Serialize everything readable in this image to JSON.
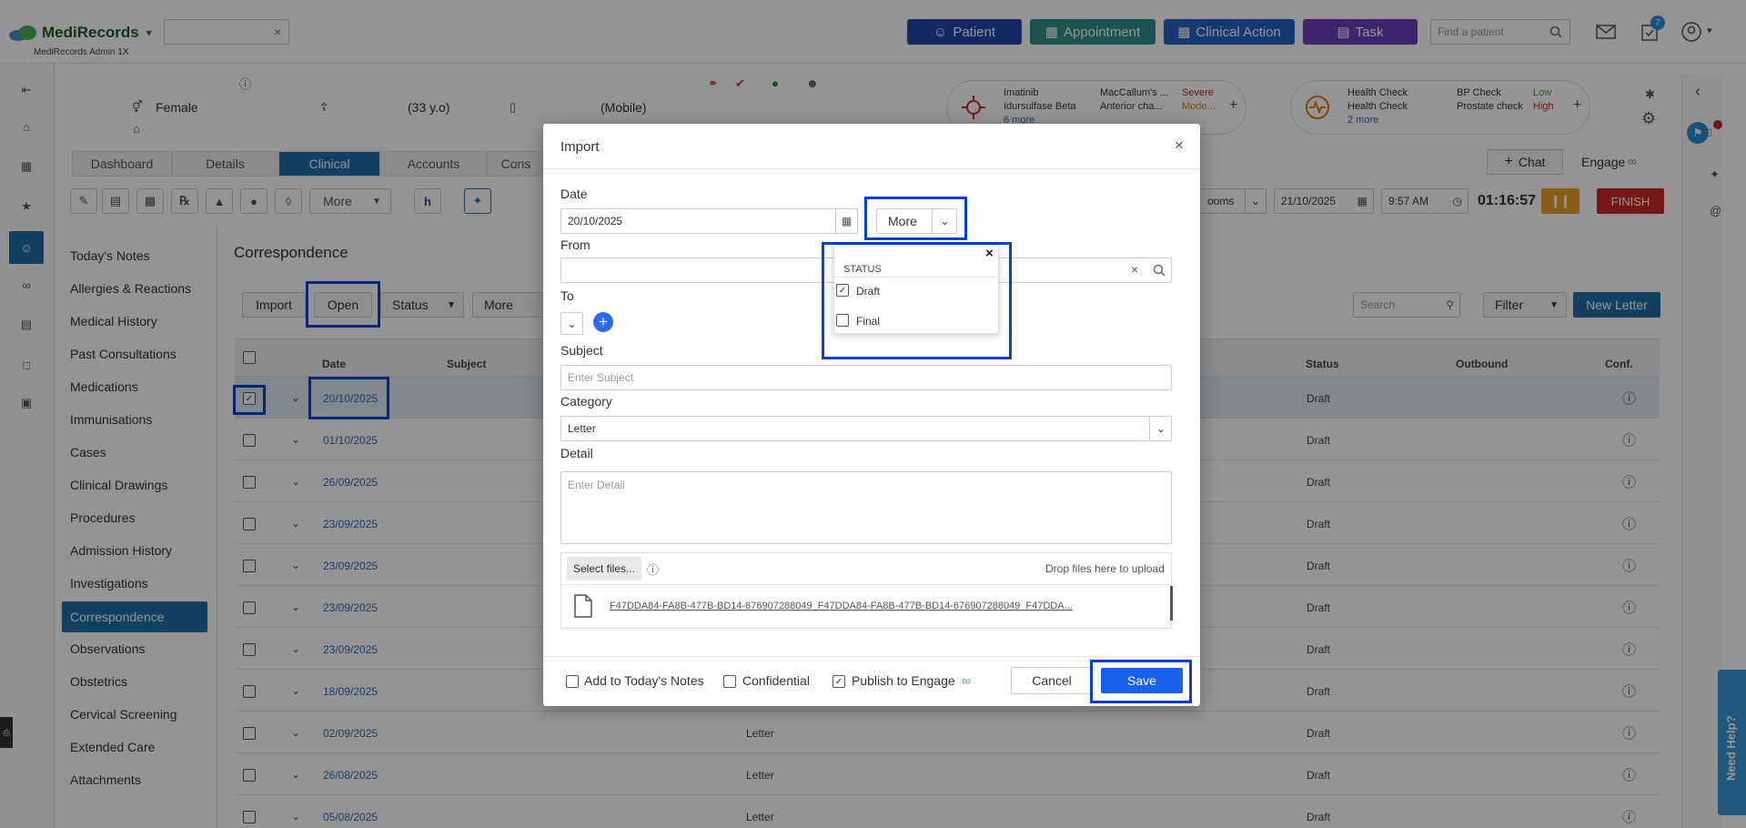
{
  "app": {
    "name": "MediRecords",
    "subtitle": "MediRecords Admin 1X"
  },
  "topbar": {
    "patient_btn": "Patient",
    "appointment_btn": "Appointment",
    "clinical_action_btn": "Clinical Action",
    "task_btn": "Task",
    "find_patient_placeholder": "Find a patient",
    "tasks_badge": "7",
    "colors": {
      "patient": "#2547a8",
      "appointment": "#2f8f8c",
      "clinical": "#2563c4",
      "task": "#6b3fb8"
    }
  },
  "patient": {
    "gender": "Female",
    "age": "(33 y.o)",
    "mobile": "(Mobile)",
    "admin": "MediRecords Admin 1X",
    "alert_drugs": [
      "Imatinib",
      "Idursulfase Beta"
    ],
    "alert_more": "6 more",
    "alert_reactions": [
      "MacCallum's ...",
      "Anterior cha..."
    ],
    "alert_severity": [
      "Severe",
      "Mode..."
    ],
    "health_checks": [
      "Health Check",
      "Health Check"
    ],
    "health_more": "2 more",
    "health_items": [
      "BP Check",
      "Prostate check"
    ],
    "health_levels": [
      "Low",
      "High"
    ]
  },
  "tabs": [
    "Dashboard",
    "Details",
    "Clinical",
    "Accounts",
    "Cons"
  ],
  "toolbar": {
    "more_label": "More",
    "chat_label": "Chat",
    "engage_label": "Engage",
    "rooms_label": "ooms",
    "date_value": "21/10/2025",
    "time_value": "9:57 AM",
    "timer": "01:16:57",
    "finish_label": "FINISH"
  },
  "nav": [
    "Today's Notes",
    "Allergies & Reactions",
    "Medical History",
    "Past Consultations",
    "Medications",
    "Immunisations",
    "Cases",
    "Clinical Drawings",
    "Procedures",
    "Admission History",
    "Investigations",
    "Correspondence",
    "Observations",
    "Obstetrics",
    "Cervical Screening",
    "Extended Care",
    "Attachments"
  ],
  "correspondence": {
    "title": "Correspondence",
    "import_label": "Import",
    "open_label": "Open",
    "status_label": "Status",
    "more_label": "More",
    "search_placeholder": "Search",
    "filter_label": "Filter",
    "new_letter_label": "New Letter",
    "columns": [
      "Date",
      "Subject",
      "Status",
      "Outbound",
      "Conf."
    ],
    "rows": [
      {
        "date": "20/10/2025",
        "category": "",
        "status": "Draft",
        "checked": true
      },
      {
        "date": "01/10/2025",
        "category": "",
        "status": "Draft",
        "checked": false
      },
      {
        "date": "26/09/2025",
        "category": "",
        "status": "Draft",
        "checked": false
      },
      {
        "date": "23/09/2025",
        "category": "",
        "status": "Draft",
        "checked": false
      },
      {
        "date": "23/09/2025",
        "category": "",
        "status": "Draft",
        "checked": false
      },
      {
        "date": "23/09/2025",
        "category": "",
        "status": "Draft",
        "checked": false
      },
      {
        "date": "23/09/2025",
        "category": "",
        "status": "Draft",
        "checked": false
      },
      {
        "date": "18/09/2025",
        "category": "",
        "status": "Draft",
        "checked": false
      },
      {
        "date": "02/09/2025",
        "category": "Letter",
        "status": "Draft",
        "checked": false
      },
      {
        "date": "26/08/2025",
        "category": "Letter",
        "status": "Draft",
        "checked": false
      },
      {
        "date": "05/08/2025",
        "category": "Letter",
        "status": "Draft",
        "checked": false
      }
    ]
  },
  "modal": {
    "title": "Import",
    "date_label": "Date",
    "date_value": "20/10/2025",
    "more_label": "More",
    "from_label": "From",
    "to_label": "To",
    "subject_label": "Subject",
    "subject_placeholder": "Enter Subject",
    "category_label": "Category",
    "category_value": "Letter",
    "detail_label": "Detail",
    "detail_placeholder": "Enter Detail",
    "select_files_label": "Select files...",
    "drop_files_label": "Drop files here to upload",
    "file_name": "F47DDA84-FA8B-477B-BD14-676907288049_F47DDA84-FA8B-477B-BD14-676907288049_F47DDA...",
    "add_today_label": "Add to Today's Notes",
    "confidential_label": "Confidential",
    "publish_label": "Publish to Engage",
    "cancel_label": "Cancel",
    "save_label": "Save"
  },
  "status_dropdown": {
    "header": "STATUS",
    "options": [
      {
        "label": "Draft",
        "checked": true
      },
      {
        "label": "Final",
        "checked": false
      }
    ]
  },
  "need_help": "Need Help?"
}
